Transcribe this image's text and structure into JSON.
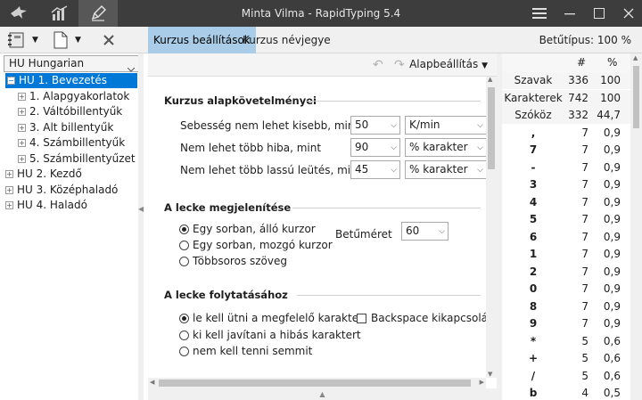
{
  "window": {
    "title": "Minta Vilma - RapidTyping 5.4"
  },
  "tabs": [
    {
      "label": "Kurzus beállítások"
    },
    {
      "label": "Kurzus névjegye"
    }
  ],
  "font_size": "Betűtípus: 100 %",
  "left": {
    "language": "HU Hungarian",
    "tree": [
      {
        "label": "HU 1. Bevezetés",
        "level": 0,
        "selected": true,
        "expanded": true
      },
      {
        "label": "1. Alapgyakorlatok",
        "level": 1
      },
      {
        "label": "2. Váltóbillentyűk",
        "level": 1
      },
      {
        "label": "3. Alt billentyűk",
        "level": 1
      },
      {
        "label": "4. Számbillentyűk",
        "level": 1
      },
      {
        "label": "5. Számbillentyűzet",
        "level": 1
      },
      {
        "label": "HU 2. Kezdő",
        "level": 0
      },
      {
        "label": "HU 3. Középhaladó",
        "level": 0
      },
      {
        "label": "HU 4. Haladó",
        "level": 0
      }
    ]
  },
  "center": {
    "defaults_label": "Alapbeállítás",
    "requirements": {
      "title": "Kurzus alapkövetelményei",
      "rows": [
        {
          "label": "Sebesség nem lehet kisebb, mint",
          "value": "50",
          "unit": "K/min"
        },
        {
          "label": "Nem lehet több hiba, mint",
          "value": "90",
          "unit": "% karakter"
        },
        {
          "label": "Nem lehet több lassú leütés, mint",
          "value": "45",
          "unit": "% karakter"
        }
      ]
    },
    "display": {
      "title": "A lecke megjelenítése",
      "options": [
        "Egy sorban, álló kurzor",
        "Egy sorban, mozgó kurzor",
        "Többsoros szöveg"
      ],
      "selected": 0,
      "font_label": "Betűméret",
      "font_value": "60"
    },
    "continue": {
      "title": "A lecke folytatásához",
      "options": [
        "le kell ütni a megfelelő karakter",
        "ki kell javítani a hibás karaktert",
        "nem kell tenni semmit"
      ],
      "selected": 0,
      "backspace_label": "Backspace kikapcsolása",
      "backspace_checked": false
    }
  },
  "stats": {
    "headers": [
      "#",
      "%"
    ],
    "rows": [
      {
        "k": "Szavak",
        "c": "336",
        "p": "100"
      },
      {
        "k": "Karakterek",
        "c": "742",
        "p": "100"
      },
      {
        "k": "Szóköz",
        "c": "332",
        "p": "44,7"
      },
      {
        "k": ",",
        "c": "7",
        "p": "0,9"
      },
      {
        "k": "7",
        "c": "7",
        "p": "0,9"
      },
      {
        "k": "-",
        "c": "7",
        "p": "0,9"
      },
      {
        "k": "3",
        "c": "7",
        "p": "0,9"
      },
      {
        "k": "4",
        "c": "7",
        "p": "0,9"
      },
      {
        "k": "5",
        "c": "7",
        "p": "0,9"
      },
      {
        "k": "6",
        "c": "7",
        "p": "0,9"
      },
      {
        "k": "1",
        "c": "7",
        "p": "0,9"
      },
      {
        "k": "2",
        "c": "7",
        "p": "0,9"
      },
      {
        "k": "0",
        "c": "7",
        "p": "0,9"
      },
      {
        "k": "8",
        "c": "7",
        "p": "0,9"
      },
      {
        "k": "9",
        "c": "7",
        "p": "0,9"
      },
      {
        "k": "*",
        "c": "5",
        "p": "0,6"
      },
      {
        "k": "+",
        "c": "5",
        "p": "0,6"
      },
      {
        "k": "/",
        "c": "5",
        "p": "0,6"
      },
      {
        "k": "b",
        "c": "4",
        "p": "0,5"
      }
    ]
  },
  "colors": {
    "selection": "#0078d7",
    "active_tab": "#a9cde8",
    "titlebar": "#3d3d3d"
  }
}
